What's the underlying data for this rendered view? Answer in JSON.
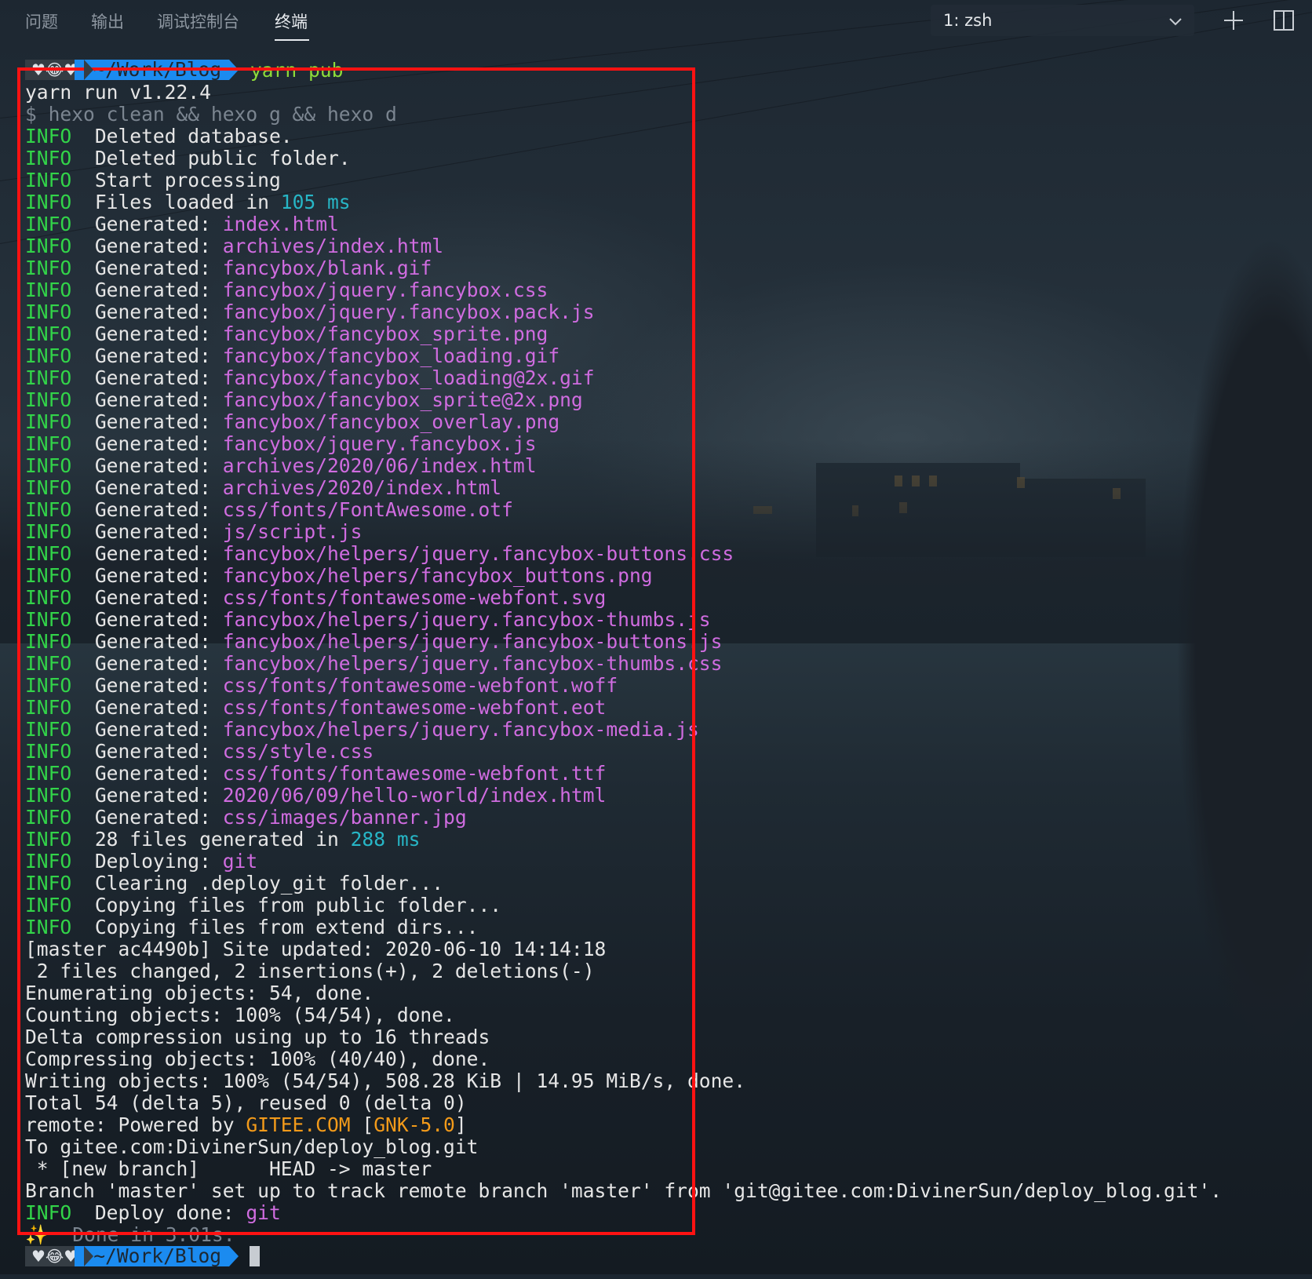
{
  "tabs": [
    {
      "label": "问题",
      "active": false
    },
    {
      "label": "输出",
      "active": false
    },
    {
      "label": "调试控制台",
      "active": false
    },
    {
      "label": "终端",
      "active": true
    }
  ],
  "terminal_select": {
    "value": "1: zsh"
  },
  "icons": {
    "dropdown": "chevron-down-icon",
    "new_terminal": "plus-icon",
    "split": "split-panel-icon"
  },
  "colors": {
    "info": "#32d449",
    "path": "#d06ce0",
    "number": "#27b6c6",
    "highlight": "#f29a1a",
    "prompt_blue": "#1b8bf0",
    "annotation_box": "#ff1212"
  },
  "prompt": {
    "emoji": "♥😂♥",
    "cwd": "~/Work/Blog",
    "command": "yarn pub"
  },
  "terminal": {
    "lines": [
      {
        "text": "yarn run v1.22.4"
      },
      {
        "text": "$ hexo clean && hexo g && hexo d",
        "style": "gray"
      },
      {
        "info": "INFO",
        "text": "  Deleted database."
      },
      {
        "info": "INFO",
        "text": "  Deleted public folder."
      },
      {
        "info": "INFO",
        "text": "  Start processing"
      },
      {
        "info": "INFO",
        "text": "  Files loaded in ",
        "num": "105 ms"
      },
      {
        "info": "INFO",
        "text": "  Generated: ",
        "path": "index.html"
      },
      {
        "info": "INFO",
        "text": "  Generated: ",
        "path": "archives/index.html"
      },
      {
        "info": "INFO",
        "text": "  Generated: ",
        "path": "fancybox/blank.gif"
      },
      {
        "info": "INFO",
        "text": "  Generated: ",
        "path": "fancybox/jquery.fancybox.css"
      },
      {
        "info": "INFO",
        "text": "  Generated: ",
        "path": "fancybox/jquery.fancybox.pack.js"
      },
      {
        "info": "INFO",
        "text": "  Generated: ",
        "path": "fancybox/fancybox_sprite.png"
      },
      {
        "info": "INFO",
        "text": "  Generated: ",
        "path": "fancybox/fancybox_loading.gif"
      },
      {
        "info": "INFO",
        "text": "  Generated: ",
        "path": "fancybox/fancybox_loading@2x.gif"
      },
      {
        "info": "INFO",
        "text": "  Generated: ",
        "path": "fancybox/fancybox_sprite@2x.png"
      },
      {
        "info": "INFO",
        "text": "  Generated: ",
        "path": "fancybox/fancybox_overlay.png"
      },
      {
        "info": "INFO",
        "text": "  Generated: ",
        "path": "fancybox/jquery.fancybox.js"
      },
      {
        "info": "INFO",
        "text": "  Generated: ",
        "path": "archives/2020/06/index.html"
      },
      {
        "info": "INFO",
        "text": "  Generated: ",
        "path": "archives/2020/index.html"
      },
      {
        "info": "INFO",
        "text": "  Generated: ",
        "path": "css/fonts/FontAwesome.otf"
      },
      {
        "info": "INFO",
        "text": "  Generated: ",
        "path": "js/script.js"
      },
      {
        "info": "INFO",
        "text": "  Generated: ",
        "path": "fancybox/helpers/jquery.fancybox-buttons.css"
      },
      {
        "info": "INFO",
        "text": "  Generated: ",
        "path": "fancybox/helpers/fancybox_buttons.png"
      },
      {
        "info": "INFO",
        "text": "  Generated: ",
        "path": "css/fonts/fontawesome-webfont.svg"
      },
      {
        "info": "INFO",
        "text": "  Generated: ",
        "path": "fancybox/helpers/jquery.fancybox-thumbs.js"
      },
      {
        "info": "INFO",
        "text": "  Generated: ",
        "path": "fancybox/helpers/jquery.fancybox-buttons.js"
      },
      {
        "info": "INFO",
        "text": "  Generated: ",
        "path": "fancybox/helpers/jquery.fancybox-thumbs.css"
      },
      {
        "info": "INFO",
        "text": "  Generated: ",
        "path": "css/fonts/fontawesome-webfont.woff"
      },
      {
        "info": "INFO",
        "text": "  Generated: ",
        "path": "css/fonts/fontawesome-webfont.eot"
      },
      {
        "info": "INFO",
        "text": "  Generated: ",
        "path": "fancybox/helpers/jquery.fancybox-media.js"
      },
      {
        "info": "INFO",
        "text": "  Generated: ",
        "path": "css/style.css"
      },
      {
        "info": "INFO",
        "text": "  Generated: ",
        "path": "css/fonts/fontawesome-webfont.ttf"
      },
      {
        "info": "INFO",
        "text": "  Generated: ",
        "path": "2020/06/09/hello-world/index.html"
      },
      {
        "info": "INFO",
        "text": "  Generated: ",
        "path": "css/images/banner.jpg"
      },
      {
        "info": "INFO",
        "text": "  28 files generated in ",
        "num": "288 ms"
      },
      {
        "info": "INFO",
        "text": "  Deploying: ",
        "path": "git"
      },
      {
        "info": "INFO",
        "text": "  Clearing .deploy_git folder..."
      },
      {
        "info": "INFO",
        "text": "  Copying files from public folder..."
      },
      {
        "info": "INFO",
        "text": "  Copying files from extend dirs..."
      },
      {
        "text": "[master ac4490b] Site updated: 2020-06-10 14:14:18"
      },
      {
        "text": " 2 files changed, 2 insertions(+), 2 deletions(-)"
      },
      {
        "text": "Enumerating objects: 54, done."
      },
      {
        "text": "Counting objects: 100% (54/54), done."
      },
      {
        "text": "Delta compression using up to 16 threads"
      },
      {
        "text": "Compressing objects: 100% (40/40), done."
      },
      {
        "text": "Writing objects: 100% (54/54), 508.28 KiB | 14.95 MiB/s, done."
      },
      {
        "text": "Total 54 (delta 5), reused 0 (delta 0)"
      },
      {
        "text": "remote: Powered by ",
        "hl1": "GITEE.COM",
        "mid": " [",
        "hl2": "GNK-5.0",
        "tail": "]"
      },
      {
        "text": "To gitee.com:DivinerSun/deploy_blog.git"
      },
      {
        "text": " * [new branch]      HEAD -> master"
      },
      {
        "text": "Branch 'master' set up to track remote branch 'master' from 'git@gitee.com:DivinerSun/deploy_blog.git'."
      },
      {
        "info": "INFO",
        "text": "  Deploy done: ",
        "path": "git"
      },
      {
        "text": "✨  Done in 3.01s.",
        "style": "gray"
      }
    ]
  }
}
